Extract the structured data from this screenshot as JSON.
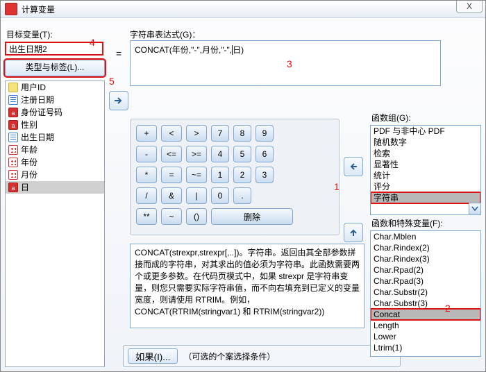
{
  "window": {
    "title": "计算变量",
    "close": "X"
  },
  "left": {
    "target_label": "目标变量(T):",
    "target_value": "出生日期2",
    "type_btn": "类型与标签(L)..."
  },
  "variables": [
    {
      "icon": "scale",
      "name": "用户ID"
    },
    {
      "icon": "date",
      "name": "注册日期"
    },
    {
      "icon": "string",
      "name": "身份证号码"
    },
    {
      "icon": "string",
      "name": "性别"
    },
    {
      "icon": "date",
      "name": "出生日期"
    },
    {
      "icon": "nominal",
      "name": "年龄"
    },
    {
      "icon": "nominal",
      "name": "年份"
    },
    {
      "icon": "nominal",
      "name": "月份"
    },
    {
      "icon": "string",
      "name": "日",
      "selected": true
    }
  ],
  "equals": "=",
  "expr_label": "字符串表达式(G)：",
  "expression": {
    "prefix": "CONCAT(年份,\"-\",月份,\"-\",",
    "suffix": "日)"
  },
  "keypad": {
    "rows": [
      [
        "+",
        "<",
        ">",
        "7",
        "8",
        "9"
      ],
      [
        "-",
        "<=",
        ">=",
        "4",
        "5",
        "6"
      ],
      [
        "*",
        "=",
        "~=",
        "1",
        "2",
        "3"
      ],
      [
        "/",
        "&",
        "|",
        "0",
        "."
      ],
      [
        "**",
        "~",
        "()"
      ]
    ],
    "delete": "删除"
  },
  "description": "CONCAT(strexpr,strexpr[,..])。字符串。返回由其全部参数拼接而成的字符串，对其求出的值必须为字符串。此函数需要两个或更多参数。在代码页模式中，如果 strexpr 是字符串变量，则您只需要实际字符串值，而不向右填充到已定义的变量宽度，则请使用 RTRIM。例如，CONCAT(RTRIM(stringvar1) 和 RTRIM(stringvar2))",
  "if": {
    "button": "如果(I)...",
    "hint": "（可选的个案选择条件）"
  },
  "fn_groups": {
    "label": "函数组(G):",
    "items": [
      "PDF 与非中心 PDF",
      "随机数字",
      "检索",
      "显著性",
      "统计",
      "评分",
      "字符串"
    ],
    "selected": "字符串"
  },
  "fn_specials": {
    "label": "函数和特殊变量(F):",
    "items": [
      "Char.Mblen",
      "Char.Rindex(2)",
      "Char.Rindex(3)",
      "Char.Rpad(2)",
      "Char.Rpad(3)",
      "Char.Substr(2)",
      "Char.Substr(3)",
      "Concat",
      "Length",
      "Lower",
      "Ltrim(1)"
    ],
    "selected": "Concat"
  },
  "annotations": {
    "a1": "1",
    "a2": "2",
    "a3": "3",
    "a4": "4",
    "a5": "5"
  }
}
